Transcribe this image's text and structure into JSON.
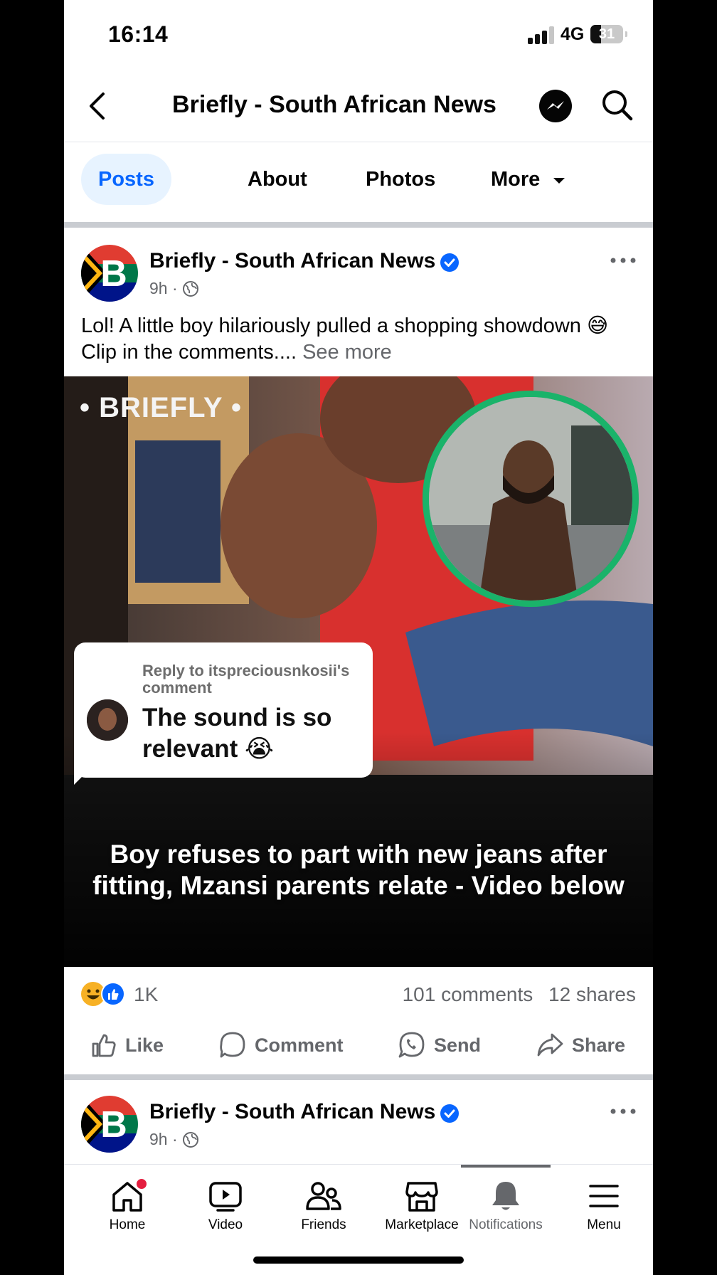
{
  "status_bar": {
    "time": "16:14",
    "network": "4G",
    "battery": "31"
  },
  "header": {
    "title": "Briefly - South African News",
    "back_icon": "chevron-left-icon",
    "messenger_icon": "messenger-icon",
    "search_icon": "search-icon"
  },
  "tabs": [
    {
      "label": "Posts",
      "active": true
    },
    {
      "label": "About",
      "active": false
    },
    {
      "label": "Photos",
      "active": false
    },
    {
      "label": "More",
      "active": false
    }
  ],
  "post": {
    "author": "Briefly - South African News",
    "time": "9h",
    "audience_icon": "globe-icon",
    "text": "Lol! A little boy hilariously pulled a shopping showdown 😅 Clip in the comments....",
    "see_more": "See more",
    "image": {
      "watermark": "• BRIEFLY •",
      "reply_to": "Reply to itspreciousnkosii's comment",
      "reply_text": "The sound is so relevant 😭",
      "caption": "Boy refuses to part with new jeans after fitting, Mzansi parents relate - Video below"
    },
    "reactions_count": "1K",
    "comments": "101 comments",
    "shares": "12 shares",
    "actions": {
      "like": "Like",
      "comment": "Comment",
      "send": "Send",
      "share": "Share"
    }
  },
  "next_post": {
    "author": "Briefly - South African News",
    "time": "9h"
  },
  "bottom_nav": [
    {
      "label": "Home",
      "icon": "home-icon"
    },
    {
      "label": "Video",
      "icon": "video-icon"
    },
    {
      "label": "Friends",
      "icon": "friends-icon"
    },
    {
      "label": "Marketplace",
      "icon": "marketplace-icon"
    },
    {
      "label": "Notifications",
      "icon": "bell-icon"
    },
    {
      "label": "Menu",
      "icon": "menu-icon"
    }
  ],
  "colors": {
    "accent": "#0866ff",
    "tab_active_bg": "#e7f3ff",
    "secondary_text": "#65676b",
    "badge_red": "#e41e3f",
    "ring_green": "#1ab36a"
  }
}
